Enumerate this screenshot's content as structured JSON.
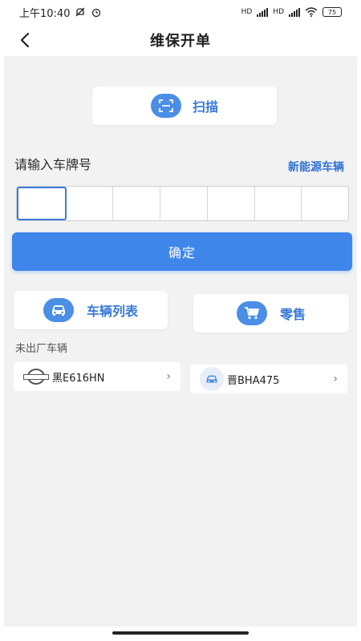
{
  "status_bar": {
    "time": "上午10:40",
    "network_labels": [
      "HD",
      "HD"
    ],
    "battery": "75"
  },
  "nav": {
    "title": "维保开单",
    "back_icon": "chevron-left-icon"
  },
  "scan": {
    "label": "扫描",
    "icon": "scan-icon"
  },
  "plate_input": {
    "label": "请输入车牌号",
    "nev_link": "新能源车辆",
    "cells": [
      "",
      "",
      "",
      "",
      "",
      "",
      ""
    ]
  },
  "confirm": {
    "label": "确定"
  },
  "actions": {
    "vehicle_list": {
      "label": "车辆列表",
      "icon": "car-icon"
    },
    "retail": {
      "label": "零售",
      "icon": "cart-icon"
    }
  },
  "unexited": {
    "label": "未出厂车辆",
    "vehicles": [
      {
        "plate": "黑E616HN",
        "logo": "nissan-logo",
        "logo_text": "NISSAN"
      },
      {
        "plate": "晋BHA475",
        "logo": "car-icon"
      }
    ]
  },
  "colors": {
    "accent": "#3f86ea",
    "accent_text": "#3a7ad8",
    "page_bg": "#f2f2f3"
  }
}
